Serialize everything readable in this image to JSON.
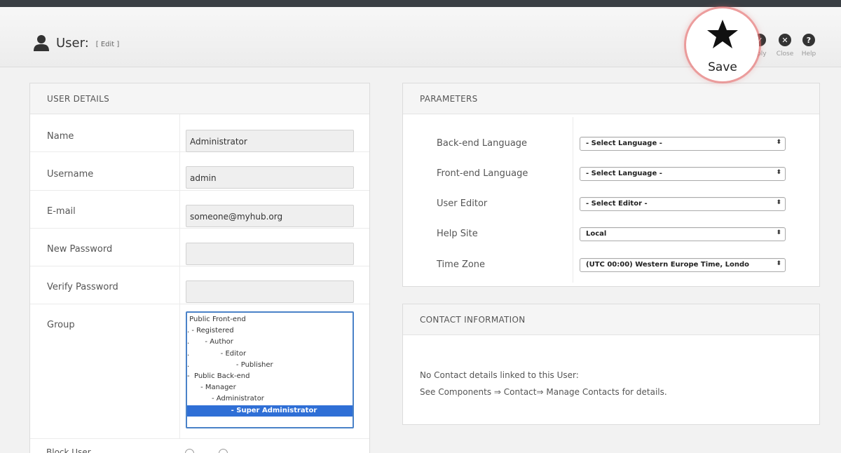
{
  "header": {
    "title": "User:",
    "subtitle": "[ Edit ]"
  },
  "toolbar": {
    "save_label": "Save",
    "apply_label": "pply",
    "close_label": "Close",
    "help_label": "Help"
  },
  "user_details": {
    "heading": "USER DETAILS",
    "fields": [
      {
        "label": "Name",
        "value": "Administrator"
      },
      {
        "label": "Username",
        "value": "admin"
      },
      {
        "label": "E-mail",
        "value": "someone@myhub.org"
      },
      {
        "label": "New Password",
        "value": ""
      },
      {
        "label": "Verify Password",
        "value": ""
      }
    ],
    "group": {
      "label": "Group",
      "items": [
        " Public Front-end",
        ". - Registered",
        ".       - Author",
        ".              - Editor",
        ".                     - Publisher",
        "-  Public Back-end",
        "      - Manager",
        "           - Administrator",
        "                  - Super Administrator"
      ],
      "selected_index": 8
    },
    "block_label": "Block User"
  },
  "parameters": {
    "heading": "PARAMETERS",
    "rows": [
      {
        "label": "Back-end Language",
        "value": "- Select Language -"
      },
      {
        "label": "Front-end Language",
        "value": "- Select Language -"
      },
      {
        "label": "User Editor",
        "value": "- Select Editor -"
      },
      {
        "label": "Help Site",
        "value": "Local"
      },
      {
        "label": "Time Zone",
        "value": "(UTC 00:00) Western Europe Time, Londo"
      }
    ]
  },
  "contact": {
    "heading": "CONTACT INFORMATION",
    "line1": "No Contact details linked to this User:",
    "line2": "See Components ⇒ Contact⇒ Manage Contacts for details."
  }
}
